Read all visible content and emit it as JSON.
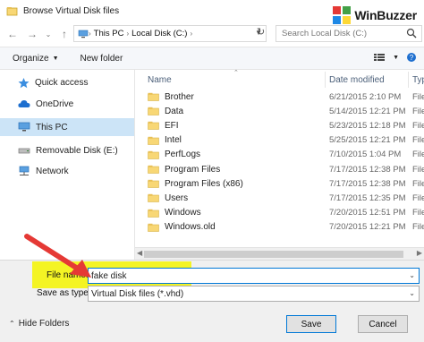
{
  "window": {
    "title": "Browse Virtual Disk files",
    "brand": "WinBuzzer"
  },
  "nav": {
    "breadcrumb": [
      "This PC",
      "Local Disk (C:)"
    ],
    "search_placeholder": "Search Local Disk (C:)"
  },
  "toolbar": {
    "organize_label": "Organize",
    "new_folder_label": "New folder"
  },
  "sidebar": {
    "items": [
      {
        "label": "Quick access",
        "icon": "star-icon"
      },
      {
        "label": "OneDrive",
        "icon": "cloud-icon"
      },
      {
        "label": "This PC",
        "icon": "computer-icon",
        "selected": true
      },
      {
        "label": "Removable Disk (E:)",
        "icon": "drive-icon"
      },
      {
        "label": "Network",
        "icon": "network-icon"
      }
    ]
  },
  "columns": {
    "name": "Name",
    "date": "Date modified",
    "type": "Type"
  },
  "files": [
    {
      "name": "Brother",
      "date": "6/21/2015 2:10 PM",
      "type": "File"
    },
    {
      "name": "Data",
      "date": "5/14/2015 12:21 PM",
      "type": "File"
    },
    {
      "name": "EFI",
      "date": "5/23/2015 12:18 PM",
      "type": "File"
    },
    {
      "name": "Intel",
      "date": "5/25/2015 12:21 PM",
      "type": "File"
    },
    {
      "name": "PerfLogs",
      "date": "7/10/2015 1:04 PM",
      "type": "File"
    },
    {
      "name": "Program Files",
      "date": "7/17/2015 12:38 PM",
      "type": "File"
    },
    {
      "name": "Program Files (x86)",
      "date": "7/17/2015 12:38 PM",
      "type": "File"
    },
    {
      "name": "Users",
      "date": "7/17/2015 12:35 PM",
      "type": "File"
    },
    {
      "name": "Windows",
      "date": "7/20/2015 12:51 PM",
      "type": "File"
    },
    {
      "name": "Windows.old",
      "date": "7/20/2015 12:21 PM",
      "type": "File"
    }
  ],
  "form": {
    "file_name_label": "File name:",
    "file_name_value": "fake disk",
    "save_type_label": "Save as type:",
    "save_type_value": "Virtual Disk files (*.vhd)"
  },
  "footer": {
    "hide_folders_label": "Hide Folders",
    "save_label": "Save",
    "cancel_label": "Cancel"
  },
  "colors": {
    "accent": "#0078d7",
    "selection": "#cce4f7",
    "folder": "#f8d775",
    "highlight": "#f5f500",
    "arrow": "#e53935"
  }
}
